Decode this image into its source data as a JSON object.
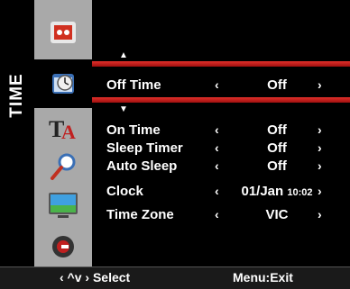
{
  "section_title": "TIME",
  "icons": [
    {
      "name": "picture-menu-icon"
    },
    {
      "name": "time-menu-icon"
    },
    {
      "name": "setup-menu-icon"
    },
    {
      "name": "search-icon"
    },
    {
      "name": "display-menu-icon"
    },
    {
      "name": "lock-menu-icon"
    }
  ],
  "selected_item": {
    "label": "Off Time",
    "value": "Off"
  },
  "items": [
    {
      "label": "On Time",
      "value": "Off"
    },
    {
      "label": "Sleep Timer",
      "value": "Off"
    },
    {
      "label": "Auto Sleep",
      "value": "Off"
    },
    {
      "label": "Clock",
      "value": "01/Jan",
      "value_small": "10:02"
    },
    {
      "label": "Time Zone",
      "value": "VIC"
    }
  ],
  "arrows": {
    "left": "‹",
    "right": "›",
    "up": "^",
    "down": "v"
  },
  "footer": {
    "nav_hint": "‹ ^v › Select",
    "exit_hint": "Menu:Exit"
  },
  "colors": {
    "highlight_bar": "#c8201c",
    "icon_column": "#a9a9a9"
  }
}
